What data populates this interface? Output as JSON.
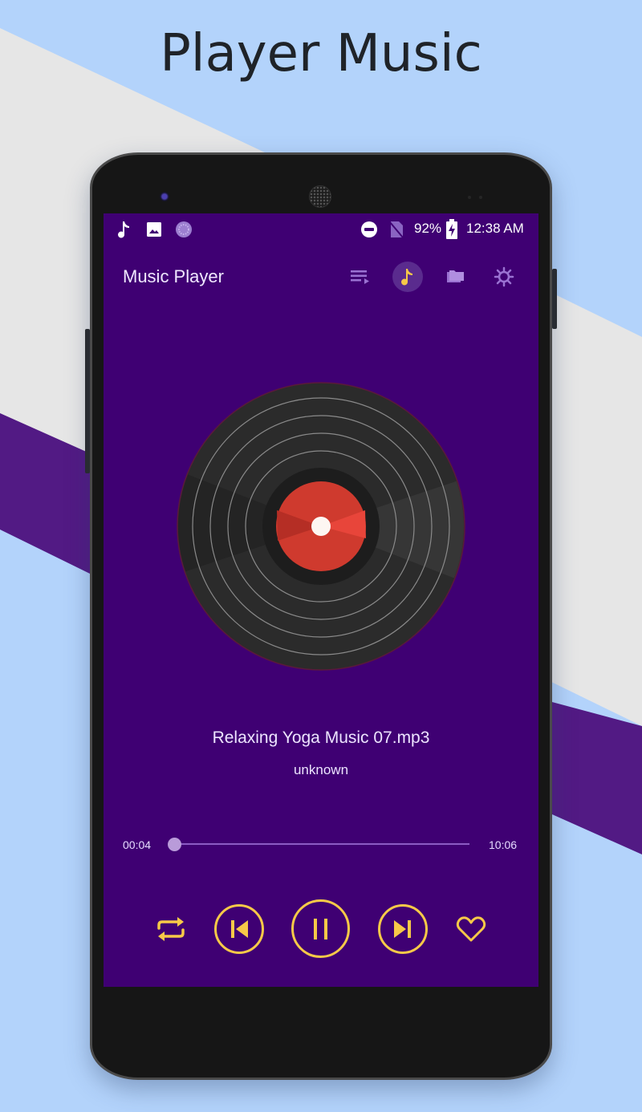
{
  "headline": "Player Music",
  "colors": {
    "background_blue": "#b3d3fb",
    "background_gray": "#e6e6e6",
    "stripe_purple": "#521a84",
    "screen_bg": "#3f0073",
    "accent": "#f7c948",
    "disc_label": "#d0362b"
  },
  "status_bar": {
    "left_icons": [
      "music-note-icon",
      "image-icon",
      "circle-app-icon"
    ],
    "right_icons": [
      "do-not-disturb-icon",
      "no-sim-icon",
      "battery-charging-icon"
    ],
    "battery": "92%",
    "time": "12:38 AM"
  },
  "app_bar": {
    "title": "Music Player",
    "actions": [
      {
        "name": "queue-icon",
        "label": "Playlist queue",
        "active": false
      },
      {
        "name": "music-note-icon",
        "label": "Now playing",
        "active": true
      },
      {
        "name": "folder-icon",
        "label": "Folders",
        "active": false
      },
      {
        "name": "settings-icon",
        "label": "Settings",
        "active": false
      }
    ]
  },
  "now_playing": {
    "title": "Relaxing Yoga Music 07.mp3",
    "artist": "unknown",
    "elapsed": "00:04",
    "duration": "10:06",
    "progress": 0.0066
  },
  "controls": {
    "repeat": "repeat-icon",
    "previous": "skip-previous-icon",
    "play_pause": "pause-icon",
    "next": "skip-next-icon",
    "favorite": "heart-icon"
  }
}
